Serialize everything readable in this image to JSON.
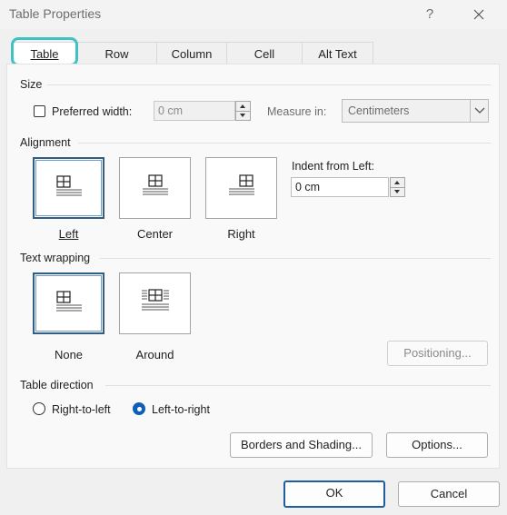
{
  "dialog": {
    "title": "Table Properties",
    "help": "?",
    "close_icon": "close-icon"
  },
  "tabs": [
    {
      "label": "Table",
      "active": true
    },
    {
      "label": "Row",
      "active": false
    },
    {
      "label": "Column",
      "active": false
    },
    {
      "label": "Cell",
      "active": false
    },
    {
      "label": "Alt Text",
      "active": false
    }
  ],
  "size": {
    "heading": "Size",
    "preferred_width_label": "Preferred width:",
    "preferred_width_checked": false,
    "preferred_width_value": "0 cm",
    "measure_in_label": "Measure in:",
    "measure_in_value": "Centimeters"
  },
  "alignment": {
    "heading": "Alignment",
    "options": [
      {
        "label": "Left",
        "selected": true
      },
      {
        "label": "Center",
        "selected": false
      },
      {
        "label": "Right",
        "selected": false
      }
    ],
    "indent_label": "Indent from Left:",
    "indent_value": "0 cm"
  },
  "text_wrapping": {
    "heading": "Text wrapping",
    "options": [
      {
        "label": "None",
        "selected": true
      },
      {
        "label": "Around",
        "selected": false
      }
    ],
    "positioning_label": "Positioning..."
  },
  "table_direction": {
    "heading": "Table direction",
    "options": [
      {
        "label": "Right-to-left",
        "checked": false
      },
      {
        "label": "Left-to-right",
        "checked": true
      }
    ]
  },
  "buttons": {
    "borders_shading": "Borders and Shading...",
    "options": "Options...",
    "ok": "OK",
    "cancel": "Cancel"
  },
  "colors": {
    "accent": "#0f5fb5",
    "focus_ring": "#3fc2c2",
    "selected_border": "#325e84"
  }
}
